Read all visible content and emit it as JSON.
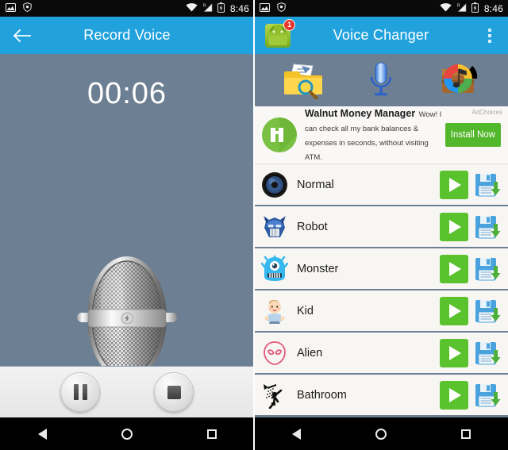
{
  "left": {
    "statusbar": {
      "icons_left": [
        "screenshot-icon",
        "shield-icon"
      ],
      "icons_right": [
        "wifi-icon",
        "signal-roaming-icon",
        "battery-charging-icon"
      ],
      "time": "8:46"
    },
    "appbar": {
      "back_icon": "arrow-left-icon",
      "title": "Record Voice",
      "color": "#21a2dd"
    },
    "recorder": {
      "timer": "00:06",
      "mic_icon": "microphone-illustration",
      "pause_label": "Pause",
      "stop_label": "Stop"
    },
    "navbar": {
      "back": "Back",
      "home": "Home",
      "recents": "Recents"
    }
  },
  "right": {
    "statusbar": {
      "icons_left": [
        "screenshot-icon",
        "shield-icon"
      ],
      "icons_right": [
        "wifi-icon",
        "signal-roaming-icon",
        "battery-charging-icon"
      ],
      "time": "8:46"
    },
    "appbar": {
      "app_icon": "android-app-icon",
      "badge": "1",
      "title": "Voice Changer",
      "overflow_icon": "overflow-menu-icon",
      "color": "#21a2dd"
    },
    "toolbar": [
      {
        "name": "browse-files-button",
        "icon": "folder-search-icon"
      },
      {
        "name": "record-button",
        "icon": "microphone-icon"
      },
      {
        "name": "music-box-button",
        "icon": "music-toolbox-icon"
      }
    ],
    "ad": {
      "adchoices_label": "AdChoices",
      "icon": "walnut-logo-icon",
      "title": "Walnut Money Manager",
      "description": "Wow! I can check all my bank balances & expenses in seconds, without visiting ATM.",
      "cta_label": "Install Now",
      "cta_color": "#53b72b"
    },
    "effects": [
      {
        "label": "Normal",
        "icon": "speaker-icon",
        "play": "play-button",
        "save": "save-button"
      },
      {
        "label": "Robot",
        "icon": "robot-icon",
        "play": "play-button",
        "save": "save-button"
      },
      {
        "label": "Monster",
        "icon": "monster-icon",
        "play": "play-button",
        "save": "save-button"
      },
      {
        "label": "Kid",
        "icon": "baby-icon",
        "play": "play-button",
        "save": "save-button"
      },
      {
        "label": "Alien",
        "icon": "alien-icon",
        "play": "play-button",
        "save": "save-button"
      },
      {
        "label": "Bathroom",
        "icon": "shower-icon",
        "play": "play-button",
        "save": "save-button"
      }
    ],
    "navbar": {
      "back": "Back",
      "home": "Home",
      "recents": "Recents"
    }
  }
}
